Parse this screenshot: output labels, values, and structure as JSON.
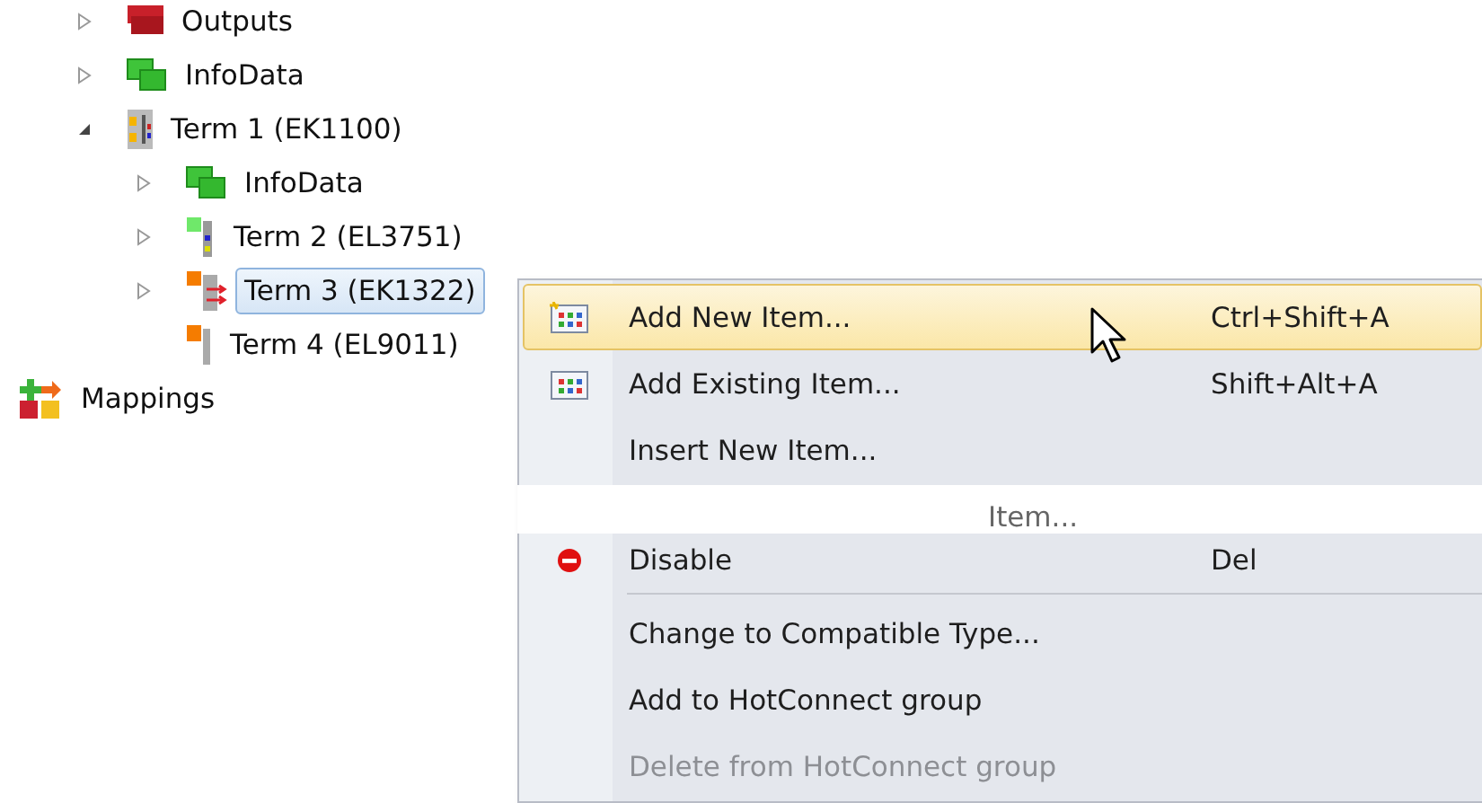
{
  "tree": {
    "devices": [
      {
        "label": "Outputs",
        "kind": "outputs",
        "expandable": true,
        "expanded": false,
        "selected": false
      },
      {
        "label": "InfoData",
        "kind": "infodata",
        "expandable": true,
        "expanded": false,
        "selected": false
      },
      {
        "label": "Term 1 (EK1100)",
        "kind": "coupler",
        "expandable": true,
        "expanded": true,
        "selected": false,
        "children": [
          {
            "label": "InfoData",
            "kind": "infodata",
            "expandable": true,
            "expanded": false,
            "selected": false
          },
          {
            "label": "Term 2 (EL3751)",
            "kind": "analog",
            "expandable": true,
            "expanded": false,
            "selected": false
          },
          {
            "label": "Term 3 (EK1322)",
            "kind": "junction",
            "expandable": true,
            "expanded": false,
            "selected": true
          },
          {
            "label": "Term 4 (EL9011)",
            "kind": "end",
            "expandable": false,
            "expanded": false,
            "selected": false
          }
        ]
      }
    ],
    "mappings": {
      "label": "Mappings",
      "kind": "mappings"
    }
  },
  "menu": {
    "items": [
      {
        "kind": "new",
        "label": "Add New Item...",
        "shortcut": "Ctrl+Shift+A",
        "highlighted": true,
        "disabled": false
      },
      {
        "kind": "existing",
        "label": "Add Existing Item...",
        "shortcut": "Shift+Alt+A",
        "highlighted": false,
        "disabled": false
      },
      {
        "kind": "plain",
        "label": "Insert New Item...",
        "highlighted": false,
        "disabled": false
      },
      {
        "kind": "tear",
        "label": "Item..."
      },
      {
        "kind": "disable",
        "label": "Disable",
        "shortcut": "Del",
        "highlighted": false,
        "disabled": false
      },
      {
        "kind": "separator"
      },
      {
        "kind": "plain",
        "label": "Change to Compatible Type...",
        "highlighted": false,
        "disabled": false
      },
      {
        "kind": "plain",
        "label": "Add to HotConnect group",
        "highlighted": false,
        "disabled": false
      },
      {
        "kind": "plain",
        "label": "Delete from HotConnect group",
        "highlighted": false,
        "disabled": true
      }
    ]
  }
}
